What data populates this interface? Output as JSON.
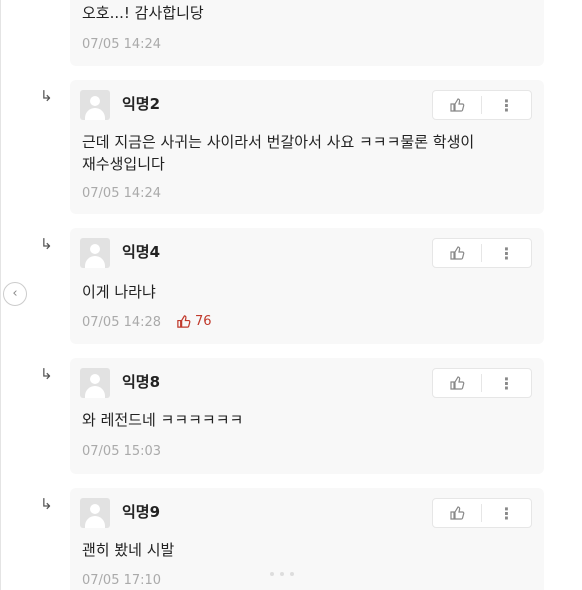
{
  "top_comment": {
    "text": "오호...! 감사합니당",
    "time": "07/05 14:24"
  },
  "replies": [
    {
      "author": "익명2",
      "text_line1": "근데 지금은 사귀는 사이라서 번갈아서 사요 ㅋㅋㅋ물론 학생이",
      "text_line2": "재수생입니다",
      "time": "07/05 14:24"
    },
    {
      "author": "익명4",
      "text": "이게 나라냐",
      "time": "07/05 14:28",
      "likes": "76"
    },
    {
      "author": "익명8",
      "text": "와 레전드네 ㅋㅋㅋㅋㅋㅋ",
      "time": "07/05 15:03"
    },
    {
      "author": "익명9",
      "text": "괜히 봤네 시발",
      "time": "07/05 17:10"
    }
  ],
  "icons": {
    "reply_arrow": "reply-arrow-icon",
    "like": "thumbs-up-icon",
    "more": "more-vertical-icon",
    "nav": "chevron-left-icon"
  },
  "colors": {
    "card_bg": "#f8f8f8",
    "like_count": "#c0392b",
    "time": "#aaaaaa"
  }
}
